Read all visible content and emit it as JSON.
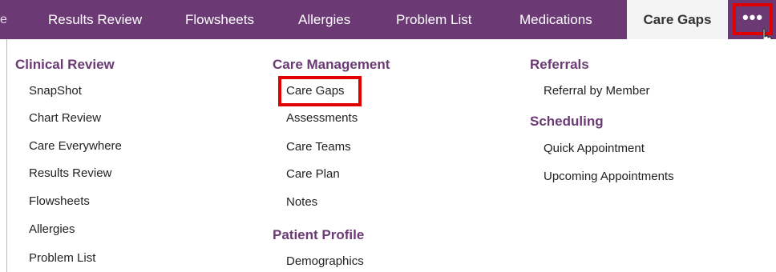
{
  "tabs": {
    "items": [
      {
        "label": "Results Review"
      },
      {
        "label": "Flowsheets"
      },
      {
        "label": "Allergies"
      },
      {
        "label": "Problem List"
      },
      {
        "label": "Medications"
      },
      {
        "label": "Care Gaps",
        "active": true
      }
    ],
    "more_label": "•••",
    "prev_edge": "e"
  },
  "menu": {
    "columns": [
      {
        "sections": [
          {
            "heading": "Clinical Review",
            "items": [
              "SnapShot",
              "Chart Review",
              "Care Everywhere",
              "Results Review",
              "Flowsheets",
              "Allergies",
              "Problem List"
            ]
          }
        ]
      },
      {
        "sections": [
          {
            "heading": "Care Management",
            "items": [
              "Care Gaps",
              "Assessments",
              "Care Teams",
              "Care Plan",
              "Notes"
            ]
          },
          {
            "heading": "Patient Profile",
            "items": [
              "Demographics"
            ]
          }
        ]
      },
      {
        "sections": [
          {
            "heading": "Referrals",
            "items": [
              "Referral by Member"
            ]
          },
          {
            "heading": "Scheduling",
            "items": [
              "Quick Appointment",
              "Upcoming Appointments"
            ]
          }
        ]
      }
    ]
  },
  "colors": {
    "accent": "#6b3a75",
    "highlight": "#e00000"
  },
  "icons": {
    "cursor": "hand-pointer-icon"
  }
}
